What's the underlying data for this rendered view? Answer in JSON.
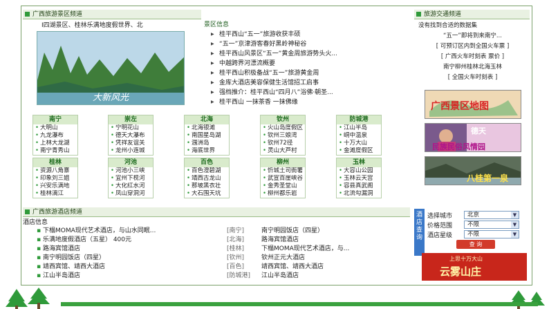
{
  "scenic": {
    "header": "广西旅游景区频道",
    "tags": "I四湖景区、桂林乐满地度假世界、北",
    "photo_caption": "大新风光",
    "news_header": "景区信息",
    "news": [
      "桂平西山“五一”旅游收获丰硕",
      "“五一”京津游客春好黑岭神秘谷",
      "桂平西山风景区“五一”黄金周旅游势头火...",
      "中越跨界河漂流概要",
      "桂平西山积极备战“五一”旅游黄金周",
      "金库大酒店美容保健生活馆招工启事",
      "强档推介：桂平西山“四月八”浴佛·朝圣...",
      "桂平西山 一抹茶香 一抹佛缘"
    ],
    "cities_row1": [
      {
        "name": "南宁",
        "items": [
          "大明山",
          "九龙瀑布",
          "上林大龙湖",
          "南宁青秀山"
        ]
      },
      {
        "name": "崇左",
        "items": [
          "宁明花山",
          "德天大瀑布",
          "凭祥友谊关",
          "龙州小连城"
        ]
      },
      {
        "name": "北海",
        "items": [
          "北海银滩",
          "南国星岛湖",
          "涠洲岛",
          "海底世界"
        ]
      },
      {
        "name": "钦州",
        "items": [
          "火山岛度假区",
          "钦州三娘湾",
          "钦州72径",
          "灵山大芦村"
        ]
      },
      {
        "name": "防城港",
        "items": [
          "江山半岛",
          "峒中温泉",
          "十万大山",
          "金滩度假区"
        ]
      }
    ],
    "cities_row2": [
      {
        "name": "桂林",
        "items": [
          "资源八角寨",
          "印象刘三姐",
          "兴安乐满地",
          "桂林漓江"
        ]
      },
      {
        "name": "河池",
        "items": [
          "河池小三峡",
          "宜州下枧河",
          "大化红水河",
          "凤山穿洞河"
        ]
      },
      {
        "name": "百色",
        "items": [
          "百色澄碧湖",
          "靖西古龙山",
          "那坡黑衣壮",
          "大石围天坑"
        ]
      },
      {
        "name": "柳州",
        "items": [
          "忻城土司衙署",
          "武宣百崖峡谷",
          "金秀圣堂山",
          "柳州都乐岩"
        ]
      },
      {
        "name": "玉林",
        "items": [
          "大容山公园",
          "玉林云天宫",
          "容县真武阁",
          "北流勾漏洞"
        ]
      }
    ]
  },
  "traffic": {
    "header": "旅游交通频道",
    "lines": [
      "没有找到合适的数据集",
      "“五一”即将到来南宁...",
      "[ 可预订区内到全国火车票 ]",
      "[ 广西火车时刻表    票价 ]",
      "南宁柳州桂林北海玉林",
      "[ 全国火车时刻表 ]"
    ],
    "banners": [
      "广西景区地图",
      "民族民俗风情园",
      "八桂第一泉"
    ],
    "banner_sub": "德天"
  },
  "hotels": {
    "header": "广西旅游酒店频道",
    "sub_header": "酒店信息",
    "rows": [
      {
        "left": "下榻MOMA现代艺术酒店，与山水同眠...",
        "region": "[南宁]",
        "right": "南宁明园饭店（四星）"
      },
      {
        "left": "乐满地度假酒店（五星） 400元",
        "region": "[北海]",
        "right": "路海宾馆酒店"
      },
      {
        "left": "路海宾馆酒店",
        "region": "[桂林]",
        "right": "下榻MOMA现代艺术酒店，与..."
      },
      {
        "left": "南宁明园饭店（四星）",
        "region": "[钦州]",
        "right": "钦州正元大酒店"
      },
      {
        "left": "靖西宾馆、靖西大酒店",
        "region": "[百色]",
        "right": "靖西宾馆、靖西大酒店"
      },
      {
        "left": "江山半岛酒店",
        "region": "[防城港]",
        "right": "江山半岛酒店"
      }
    ]
  },
  "search": {
    "sidebar": "酒店查询",
    "city_label": "选择城市",
    "city_value": "北京",
    "price_label": "价格范围",
    "price_value": "不限",
    "star_label": "酒店星级",
    "star_value": "不限",
    "button": "查 询",
    "ad_top": "上思十万大山",
    "ad_main": "云雾山庄"
  }
}
